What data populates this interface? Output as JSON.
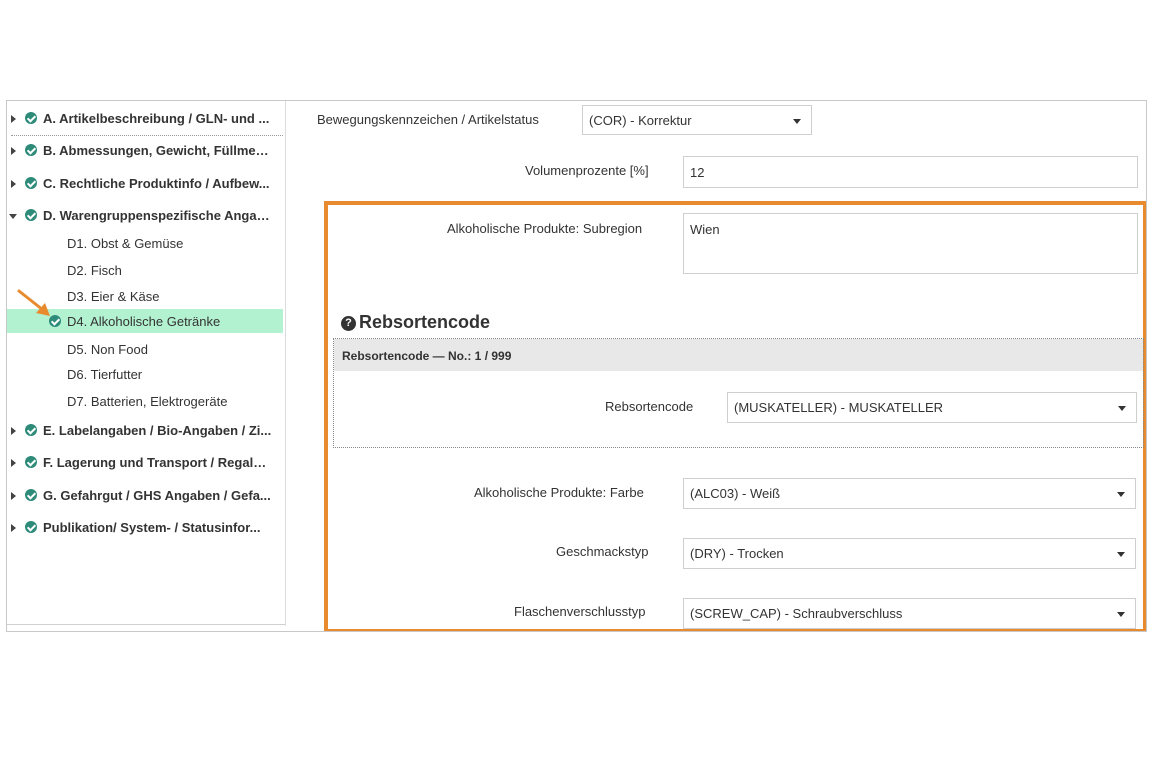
{
  "sidebar": {
    "sections": [
      {
        "label": "A. Artikelbeschreibung / GLN- und ...",
        "expanded": false
      },
      {
        "label": "B. Abmessungen, Gewicht, Füllmen...",
        "expanded": false
      },
      {
        "label": "C. Rechtliche Produktinfo / Aufbew...",
        "expanded": false
      },
      {
        "label": "D. Warengruppenspezifische Angab...",
        "expanded": true
      },
      {
        "label": "E. Labelangaben / Bio-Angaben / Zi...",
        "expanded": false
      },
      {
        "label": "F. Lagerung und Transport / Regalei...",
        "expanded": false
      },
      {
        "label": "G. Gefahrgut / GHS Angaben / Gefa...",
        "expanded": false
      },
      {
        "label": "Publikation/ System- / Statusinfor...",
        "expanded": false
      }
    ],
    "subitems": [
      {
        "label": "D1. Obst & Gemüse"
      },
      {
        "label": "D2. Fisch"
      },
      {
        "label": "D3. Eier & Käse"
      },
      {
        "label": "D4. Alkoholische Getränke",
        "active": true
      },
      {
        "label": "D5. Non Food"
      },
      {
        "label": "D6. Tierfutter"
      },
      {
        "label": "D7. Batterien, Elektrogeräte"
      }
    ]
  },
  "main": {
    "status": {
      "label": "Bewegungskennzeichen / Artikelstatus",
      "value": "(COR) - Korrektur"
    },
    "volume": {
      "label": "Volumenprozente [%]",
      "value": "12"
    },
    "subregion": {
      "label": "Alkoholische Produkte: Subregion",
      "value": "Wien"
    },
    "rebsorte_section": {
      "title": "Rebsortencode",
      "header": "Rebsortencode — No.: 1 / 999",
      "field_label": "Rebsortencode",
      "value": "(MUSKATELLER) - MUSKATELLER"
    },
    "farbe": {
      "label": "Alkoholische Produkte: Farbe",
      "value": "(ALC03) - Weiß"
    },
    "geschmack": {
      "label": "Geschmackstyp",
      "value": "(DRY) - Trocken"
    },
    "verschluss": {
      "label": "Flaschenverschlusstyp",
      "value": "(SCREW_CAP) - Schraubverschluss"
    }
  },
  "colors": {
    "highlight": "#e88b2e",
    "active_item": "#b3f2d0",
    "check": "#2e8b7a",
    "annotation_arrow": "#e88b2e"
  }
}
